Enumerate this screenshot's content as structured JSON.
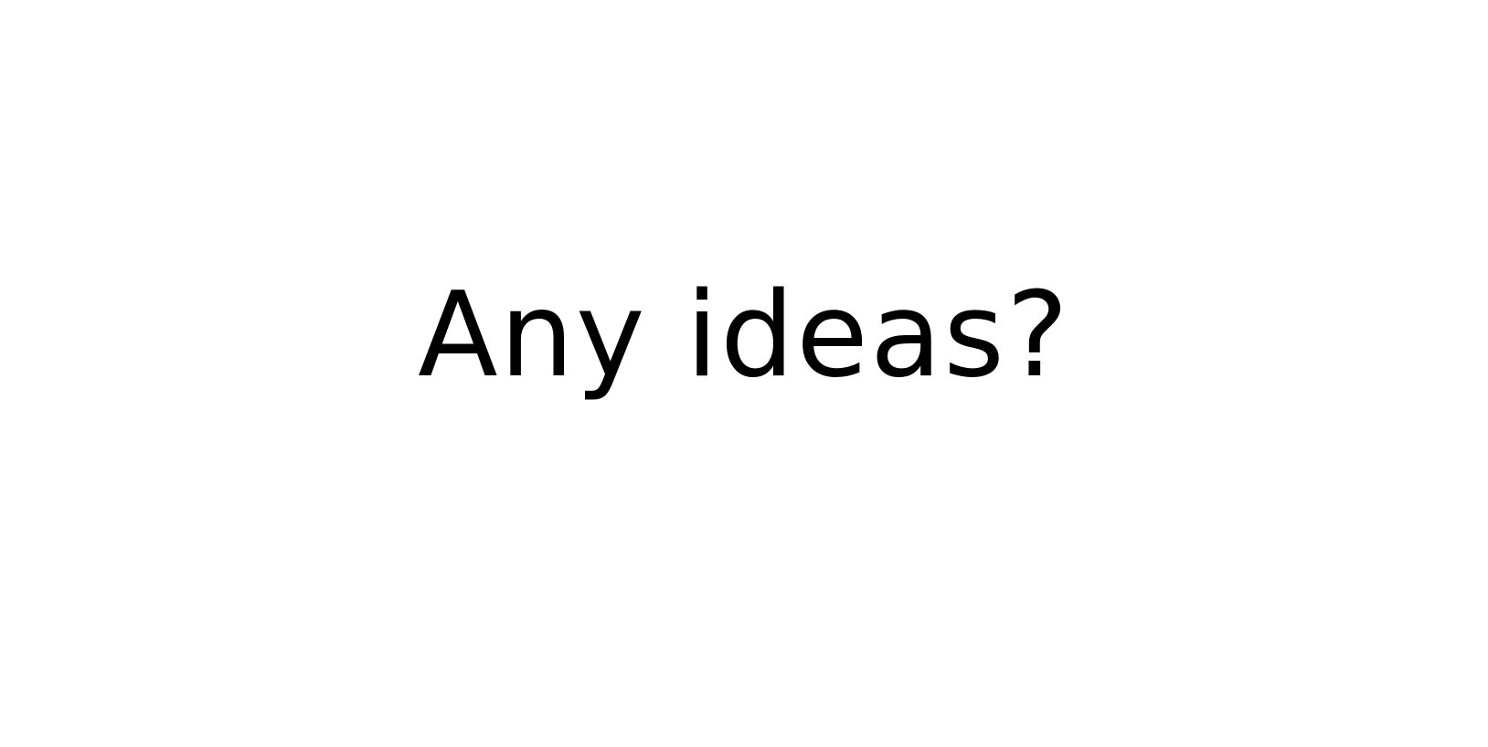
{
  "slide": {
    "headline": "Any ideas?",
    "text_color": "#000000",
    "background_color": "#ffffff"
  }
}
